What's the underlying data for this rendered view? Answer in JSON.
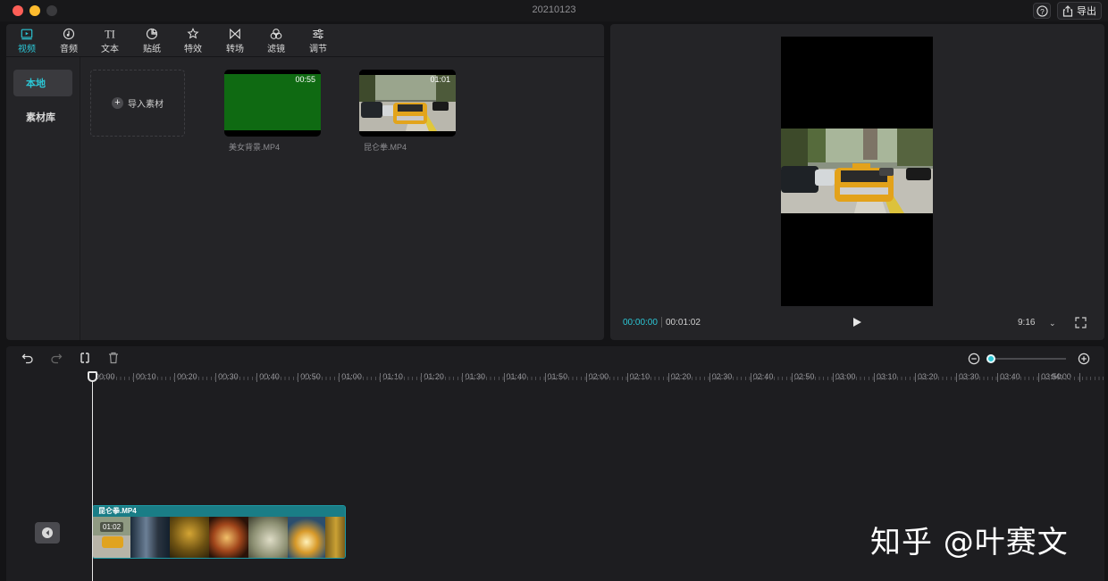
{
  "window": {
    "title": "20210123",
    "export_label": "导出"
  },
  "media_toolbar": {
    "tabs": [
      {
        "label": "视频",
        "icon": "video-icon",
        "active": true
      },
      {
        "label": "音频",
        "icon": "audio-icon"
      },
      {
        "label": "文本",
        "icon": "text-icon"
      },
      {
        "label": "贴纸",
        "icon": "sticker-icon"
      },
      {
        "label": "特效",
        "icon": "effects-icon"
      },
      {
        "label": "转场",
        "icon": "transition-icon"
      },
      {
        "label": "滤镜",
        "icon": "filter-icon"
      },
      {
        "label": "调节",
        "icon": "adjust-icon"
      }
    ]
  },
  "sidebar": {
    "items": [
      {
        "label": "本地",
        "active": true
      },
      {
        "label": "素材库"
      }
    ]
  },
  "media": {
    "import_label": "导入素材",
    "items": [
      {
        "name": "美女背景.MP4",
        "duration": "00:55",
        "color": "#0f6a12"
      },
      {
        "name": "昆仑拳.MP4",
        "duration": "01:01"
      }
    ]
  },
  "preview": {
    "current_time": "00:00:00",
    "total_time": "00:01:02",
    "ratio": "9:16"
  },
  "timeline": {
    "ruler": [
      "00:00",
      "00:10",
      "00:20",
      "00:30",
      "00:40",
      "00:50",
      "01:00",
      "01:10",
      "01:20",
      "01:30",
      "01:40",
      "01:50",
      "02:00",
      "02:10",
      "02:20",
      "02:30",
      "02:40",
      "02:50",
      "03:00",
      "03:10",
      "03:20",
      "03:30",
      "03:40",
      "03:50",
      "04:00"
    ],
    "clip": {
      "name": "昆仑拳.MP4",
      "duration": "01:02"
    }
  },
  "watermark": "知乎 @叶赛文",
  "colors": {
    "accent": "#2cc7d6",
    "clip": "#1a7d86"
  }
}
